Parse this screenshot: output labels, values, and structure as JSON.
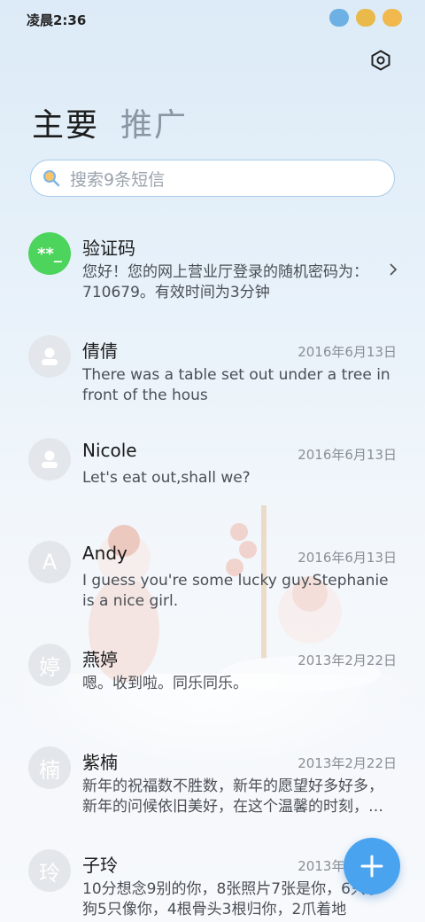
{
  "status_bar": {
    "time": "凌晨2:36"
  },
  "tabs": [
    {
      "label": "主要",
      "active": true
    },
    {
      "label": "推广",
      "active": false
    }
  ],
  "search": {
    "placeholder": "搜索9条短信"
  },
  "messages": [
    {
      "avatar": "**_",
      "avatar_type": "green",
      "name": "验证码",
      "date": "",
      "preview": "您好！您的网上营业厅登录的随机密码为：710679。有效时间为3分钟",
      "has_chevron": true
    },
    {
      "avatar": "person-icon",
      "avatar_type": "icon",
      "name": "倩倩",
      "date": "2016年6月13日",
      "preview": "There was a table set out under a tree in front of the hous"
    },
    {
      "avatar": "person-icon",
      "avatar_type": "icon",
      "name": "Nicole",
      "date": "2016年6月13日",
      "preview": "Let's eat out,shall we?"
    },
    {
      "avatar": "A",
      "avatar_type": "letter",
      "name": "Andy",
      "date": "2016年6月13日",
      "preview": "I guess you're some lucky guy.Stephanie is a nice girl."
    },
    {
      "avatar": "婷",
      "avatar_type": "letter",
      "name": "燕婷",
      "date": "2013年2月22日",
      "preview": "嗯。收到啦。同乐同乐。"
    },
    {
      "avatar": "楠",
      "avatar_type": "letter",
      "name": "紫楠",
      "date": "2013年2月22日",
      "preview": "新年的祝福数不胜数，新年的愿望好多好多，新年的问候依旧美好，在这个温馨的时刻，…"
    },
    {
      "avatar": "玲",
      "avatar_type": "letter",
      "name": "子玲",
      "date": "2013年2月22日",
      "preview": "10分想念9别的你，8张照片7张是你，6只小狗5只像你，4根骨头3根归你，2爪着地"
    }
  ],
  "colors": {
    "accent": "#4aa3ee",
    "green_avatar": "#4cd45d"
  }
}
